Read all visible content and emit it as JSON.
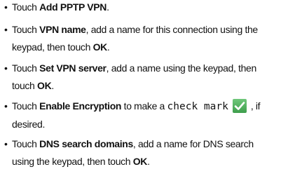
{
  "steps": [
    {
      "lead": "Touch ",
      "bold": "Add PPTP VPN",
      "tail": "."
    },
    {
      "lead": "Touch ",
      "bold": "VPN name",
      "tail": ", add a name for this connection using the",
      "line2": "keypad, then touch ",
      "bold2": "OK",
      "tail2": "."
    },
    {
      "lead": "Touch ",
      "bold": "Set VPN server",
      "tail": ", add a name using the keypad, then",
      "line2": "touch ",
      "bold2": "OK",
      "tail2": "."
    },
    {
      "lead": "Touch ",
      "bold": "Enable Encryption",
      "tail": " to make a ",
      "mono": "check mark",
      "icon": "green-check-icon",
      "after_icon": ", if",
      "line2": "desired."
    },
    {
      "lead": "Touch ",
      "bold": "DNS search domains",
      "tail": ", add a name for DNS search",
      "line2": "using the keypad, then touch ",
      "bold2": "OK",
      "tail2": "."
    }
  ],
  "colors": {
    "text": "#111111",
    "check_green": "#4caf50"
  }
}
